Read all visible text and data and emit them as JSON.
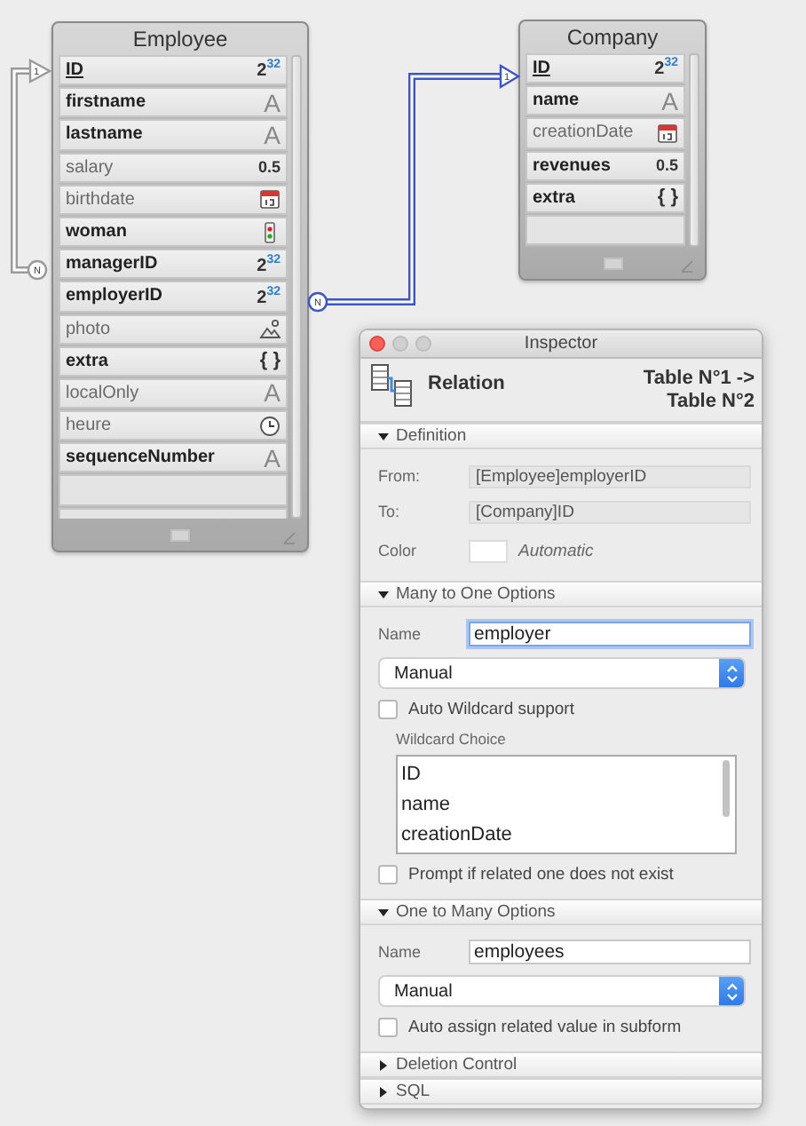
{
  "canvas": {
    "tables": [
      {
        "title": "Employee",
        "fields": [
          {
            "name": "ID",
            "bold": true,
            "primary": true,
            "kind": "integer",
            "type_text": "2$^{32}$"
          },
          {
            "name": "firstname",
            "bold": true,
            "primary": false,
            "kind": "alpha",
            "type_text": "A"
          },
          {
            "name": "lastname",
            "bold": true,
            "primary": false,
            "kind": "alpha",
            "type_text": "A"
          },
          {
            "name": "salary",
            "bold": false,
            "primary": false,
            "kind": "real",
            "type_text": "0.5"
          },
          {
            "name": "birthdate",
            "bold": false,
            "primary": false,
            "kind": "date"
          },
          {
            "name": "woman",
            "bold": true,
            "primary": false,
            "kind": "boolean"
          },
          {
            "name": "managerID",
            "bold": true,
            "primary": false,
            "kind": "integer",
            "type_text": "2$^{32}$"
          },
          {
            "name": "employerID",
            "bold": true,
            "primary": false,
            "kind": "integer",
            "type_text": "2$^{32}$"
          },
          {
            "name": "photo",
            "bold": false,
            "primary": false,
            "kind": "picture"
          },
          {
            "name": "extra",
            "bold": true,
            "primary": false,
            "kind": "object",
            "type_text": "{ }"
          },
          {
            "name": "localOnly",
            "bold": false,
            "primary": false,
            "kind": "alpha",
            "type_text": "A"
          },
          {
            "name": "heure",
            "bold": false,
            "primary": false,
            "kind": "time"
          },
          {
            "name": "sequenceNumber",
            "bold": true,
            "primary": false,
            "kind": "alpha",
            "type_text": "A"
          }
        ]
      },
      {
        "title": "Company",
        "fields": [
          {
            "name": "ID",
            "bold": true,
            "primary": true,
            "kind": "integer",
            "type_text": "2$^{32}$"
          },
          {
            "name": "name",
            "bold": true,
            "primary": false,
            "kind": "alpha",
            "type_text": "A"
          },
          {
            "name": "creationDate",
            "bold": false,
            "primary": false,
            "kind": "date"
          },
          {
            "name": "revenues",
            "bold": true,
            "primary": false,
            "kind": "real",
            "type_text": "0.5"
          },
          {
            "name": "extra",
            "bold": true,
            "primary": false,
            "kind": "object",
            "type_text": "{ }"
          }
        ]
      }
    ],
    "relations": [
      {
        "from_marker": "N",
        "to_marker": "1",
        "selected": false
      },
      {
        "from_marker": "N",
        "to_marker": "1",
        "selected": true
      }
    ]
  },
  "inspector": {
    "title": "Inspector",
    "buttons": [
      {
        "kind": "close",
        "disabled": false
      },
      {
        "kind": "minimize",
        "disabled": true
      },
      {
        "kind": "zoom",
        "disabled": true
      }
    ],
    "header": {
      "title": "Relation",
      "subtitle": "Table N°1 -> Table N°2"
    },
    "sections": [
      {
        "title": "Definition",
        "expanded": true,
        "rows": [
          {
            "kind": "readonly",
            "label": "From:",
            "value": "[Employee]employerID"
          },
          {
            "kind": "readonly",
            "label": "To:",
            "value": "[Company]ID"
          },
          {
            "kind": "color",
            "label": "Color",
            "color": "#ffffff",
            "note": "Automatic"
          }
        ]
      },
      {
        "title": "Many to One Options",
        "expanded": true,
        "rows": [
          {
            "kind": "text",
            "label": "Name",
            "value": "employer",
            "focused": true
          },
          {
            "kind": "popup",
            "value": "Manual"
          },
          {
            "kind": "checkbox",
            "label": "Auto Wildcard support",
            "checked": false
          },
          {
            "kind": "list",
            "label": "Wildcard Choice",
            "items": [
              "ID",
              "name",
              "creationDate"
            ]
          },
          {
            "kind": "checkbox",
            "label": "Prompt if related one does not exist",
            "checked": false
          }
        ]
      },
      {
        "title": "One to Many Options",
        "expanded": true,
        "rows": [
          {
            "kind": "text",
            "label": "Name",
            "value": "employees",
            "focused": false
          },
          {
            "kind": "popup",
            "value": "Manual"
          },
          {
            "kind": "checkbox",
            "label": "Auto assign related value in subform",
            "checked": false
          }
        ]
      },
      {
        "title": "Deletion Control",
        "expanded": false
      },
      {
        "title": "SQL",
        "expanded": false
      }
    ]
  }
}
